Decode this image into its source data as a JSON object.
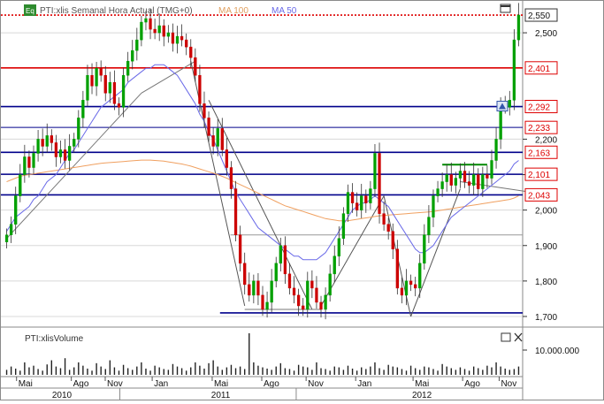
{
  "legend": {
    "series_label": "PTI:xlis Semanal Hora Actual (TMG+0)",
    "ma_label_1": "MA 100",
    "ma_label_2": "MA 50",
    "badge": "Eq"
  },
  "volume_panel": {
    "label": "PTI:xlisVolume",
    "axis_label": "10.000.000"
  },
  "colors": {
    "bull": "#00a000",
    "bear": "#cc0000",
    "ma50": "#6a6ae8",
    "ma100": "#f0a060",
    "trend_blue": "#00008b",
    "trend_red": "#dd0000",
    "trend_green": "#008800",
    "price_tag_red": "#dd0000",
    "price_tag_blue": "#0000aa",
    "current_price_tag": "#ffffff"
  },
  "chart_data": {
    "type": "candlestick",
    "y_axis": {
      "range": [
        1680,
        2580
      ],
      "ticks": [
        {
          "value": 1700,
          "label": "1,700"
        },
        {
          "value": 1800,
          "label": "1,800"
        },
        {
          "value": 1900,
          "label": "1,900"
        },
        {
          "value": 2000,
          "label": "2,000"
        },
        {
          "value": 2100,
          "label": "2,100"
        },
        {
          "value": 2200,
          "label": "2,200"
        },
        {
          "value": 2500,
          "label": "2,500"
        }
      ],
      "price_tags": [
        {
          "value": 2550,
          "label": "2,550",
          "style": "current"
        },
        {
          "value": 2401,
          "label": "2,401",
          "style": "red"
        },
        {
          "value": 2292,
          "label": "2,292",
          "style": "red"
        },
        {
          "value": 2233,
          "label": "2,233",
          "style": "red"
        },
        {
          "value": 2163,
          "label": "2,163",
          "style": "red"
        },
        {
          "value": 2101,
          "label": "2,101",
          "style": "red"
        },
        {
          "value": 2043,
          "label": "2,043",
          "style": "red"
        }
      ]
    },
    "horizontal_lines": [
      {
        "value": 2550,
        "color": "red",
        "dash": true
      },
      {
        "value": 2401,
        "color": "red"
      },
      {
        "value": 2292,
        "color": "blue"
      },
      {
        "value": 2233,
        "color": "blue",
        "thin": true
      },
      {
        "value": 2163,
        "color": "blue"
      },
      {
        "value": 2101,
        "color": "blue"
      },
      {
        "value": 2043,
        "color": "blue"
      },
      {
        "value": 1930,
        "color": "gray",
        "start": 0.44
      },
      {
        "value": 1710,
        "color": "blue",
        "start": 0.42
      }
    ],
    "x_axis": {
      "months": [
        "Mai",
        "Ago",
        "Nov",
        "Jan",
        "Mai",
        "Ago",
        "Nov",
        "Jan",
        "Mai",
        "Ago",
        "Nov"
      ],
      "month_positions": [
        0.03,
        0.135,
        0.2,
        0.29,
        0.405,
        0.5,
        0.585,
        0.68,
        0.79,
        0.885,
        0.955
      ],
      "years": [
        "2010",
        "2011",
        "2012"
      ],
      "year_positions": [
        0.115,
        0.42,
        0.805
      ]
    },
    "candles_close": [
      1930,
      1960,
      2040,
      2100,
      2150,
      2120,
      2160,
      2200,
      2180,
      2210,
      2190,
      2150,
      2170,
      2140,
      2180,
      2200,
      2260,
      2310,
      2380,
      2350,
      2400,
      2380,
      2330,
      2360,
      2300,
      2290,
      2380,
      2420,
      2450,
      2480,
      2530,
      2540,
      2510,
      2500,
      2520,
      2490,
      2500,
      2470,
      2490,
      2480,
      2460,
      2430,
      2380,
      2300,
      2260,
      2210,
      2180,
      2230,
      2170,
      2120,
      2060,
      1930,
      1850,
      1790,
      1760,
      1800,
      1760,
      1720,
      1740,
      1800,
      1850,
      1900,
      1820,
      1780,
      1760,
      1730,
      1720,
      1800,
      1780,
      1740,
      1720,
      1760,
      1820,
      1870,
      1920,
      1990,
      2050,
      2020,
      2000,
      2040,
      2020,
      2060,
      2160,
      1990,
      1960,
      1940,
      1890,
      1780,
      1760,
      1800,
      1790,
      1780,
      1850,
      1930,
      1980,
      2040,
      2060,
      2080,
      2100,
      2070,
      2090,
      2110,
      2080,
      2070,
      2100,
      2060,
      2100,
      2090,
      2140,
      2200,
      2300,
      2290,
      2310,
      2480,
      2550
    ],
    "ma50": [
      1940,
      1960,
      1980,
      1990,
      2000,
      2010,
      2030,
      2040,
      2060,
      2080,
      2090,
      2100,
      2120,
      2140,
      2160,
      2170,
      2190,
      2210,
      2230,
      2250,
      2270,
      2290,
      2300,
      2310,
      2320,
      2330,
      2340,
      2360,
      2370,
      2380,
      2390,
      2400,
      2400,
      2410,
      2410,
      2410,
      2400,
      2390,
      2380,
      2360,
      2340,
      2320,
      2300,
      2270,
      2250,
      2220,
      2200,
      2170,
      2140,
      2110,
      2080,
      2050,
      2030,
      2010,
      1990,
      1970,
      1950,
      1940,
      1930,
      1920,
      1910,
      1900,
      1890,
      1880,
      1870,
      1870,
      1860,
      1860,
      1860,
      1860,
      1870,
      1880,
      1900,
      1920,
      1940,
      1960,
      1980,
      2000,
      2010,
      2020,
      2020,
      2030,
      2040,
      2030,
      2020,
      2010,
      1990,
      1970,
      1950,
      1930,
      1910,
      1890,
      1880,
      1880,
      1890,
      1900,
      1920,
      1940,
      1960,
      1980,
      1990,
      2000,
      2010,
      2020,
      2030,
      2040,
      2050,
      2060,
      2070,
      2080,
      2090,
      2100,
      2110,
      2130,
      2140
    ],
    "ma100": [
      2080,
      2085,
      2090,
      2095,
      2098,
      2100,
      2102,
      2104,
      2106,
      2108,
      2110,
      2112,
      2114,
      2116,
      2118,
      2120,
      2122,
      2124,
      2126,
      2128,
      2130,
      2132,
      2133,
      2134,
      2135,
      2136,
      2137,
      2138,
      2139,
      2140,
      2141,
      2141,
      2141,
      2140,
      2139,
      2138,
      2136,
      2134,
      2132,
      2130,
      2127,
      2124,
      2120,
      2116,
      2112,
      2108,
      2104,
      2100,
      2095,
      2090,
      2084,
      2078,
      2072,
      2066,
      2060,
      2054,
      2048,
      2042,
      2036,
      2030,
      2024,
      2018,
      2012,
      2008,
      2004,
      2000,
      1996,
      1992,
      1988,
      1984,
      1980,
      1976,
      1974,
      1972,
      1970,
      1970,
      1970,
      1972,
      1974,
      1976,
      1978,
      1980,
      1982,
      1984,
      1985,
      1986,
      1987,
      1988,
      1989,
      1990,
      1991,
      1992,
      1993,
      1994,
      1995,
      1996,
      1998,
      2000,
      2002,
      2004,
      2006,
      2008,
      2010,
      2012,
      2014,
      2016,
      2018,
      2020,
      2022,
      2024,
      2026,
      2028,
      2030,
      2034,
      2040
    ],
    "volume": [
      0.12,
      0.2,
      0.15,
      0.1,
      0.3,
      0.18,
      0.22,
      0.14,
      0.1,
      0.25,
      0.35,
      0.2,
      0.16,
      0.4,
      0.12,
      0.18,
      0.3,
      0.22,
      0.15,
      0.1,
      0.28,
      0.2,
      0.14,
      0.35,
      0.18,
      0.1,
      0.24,
      0.16,
      0.12,
      0.2,
      0.3,
      0.15,
      0.1,
      0.22,
      0.18,
      0.14,
      0.12,
      0.26,
      0.2,
      0.16,
      0.1,
      0.18,
      0.3,
      0.22,
      0.15,
      0.28,
      0.35,
      0.2,
      0.12,
      0.18,
      0.24,
      0.16,
      0.2,
      0.14,
      1.0,
      0.3,
      0.22,
      0.18,
      0.15,
      0.12,
      0.2,
      0.28,
      0.16,
      0.14,
      0.1,
      0.24,
      0.2,
      0.18,
      0.12,
      0.3,
      0.16,
      0.14,
      0.1,
      0.2,
      0.18,
      0.12,
      0.22,
      0.15,
      0.1,
      0.18,
      0.14,
      0.2,
      0.3,
      0.16,
      0.12,
      0.24,
      0.2,
      0.18,
      0.14,
      0.1,
      0.22,
      0.16,
      0.12,
      0.2,
      0.18,
      0.14,
      0.1,
      0.26,
      0.2,
      0.16,
      0.12,
      0.18,
      0.14,
      0.1,
      0.2,
      0.16,
      0.12,
      0.22,
      0.18,
      0.3,
      0.2,
      0.15,
      0.12,
      0.14,
      0.2
    ]
  }
}
